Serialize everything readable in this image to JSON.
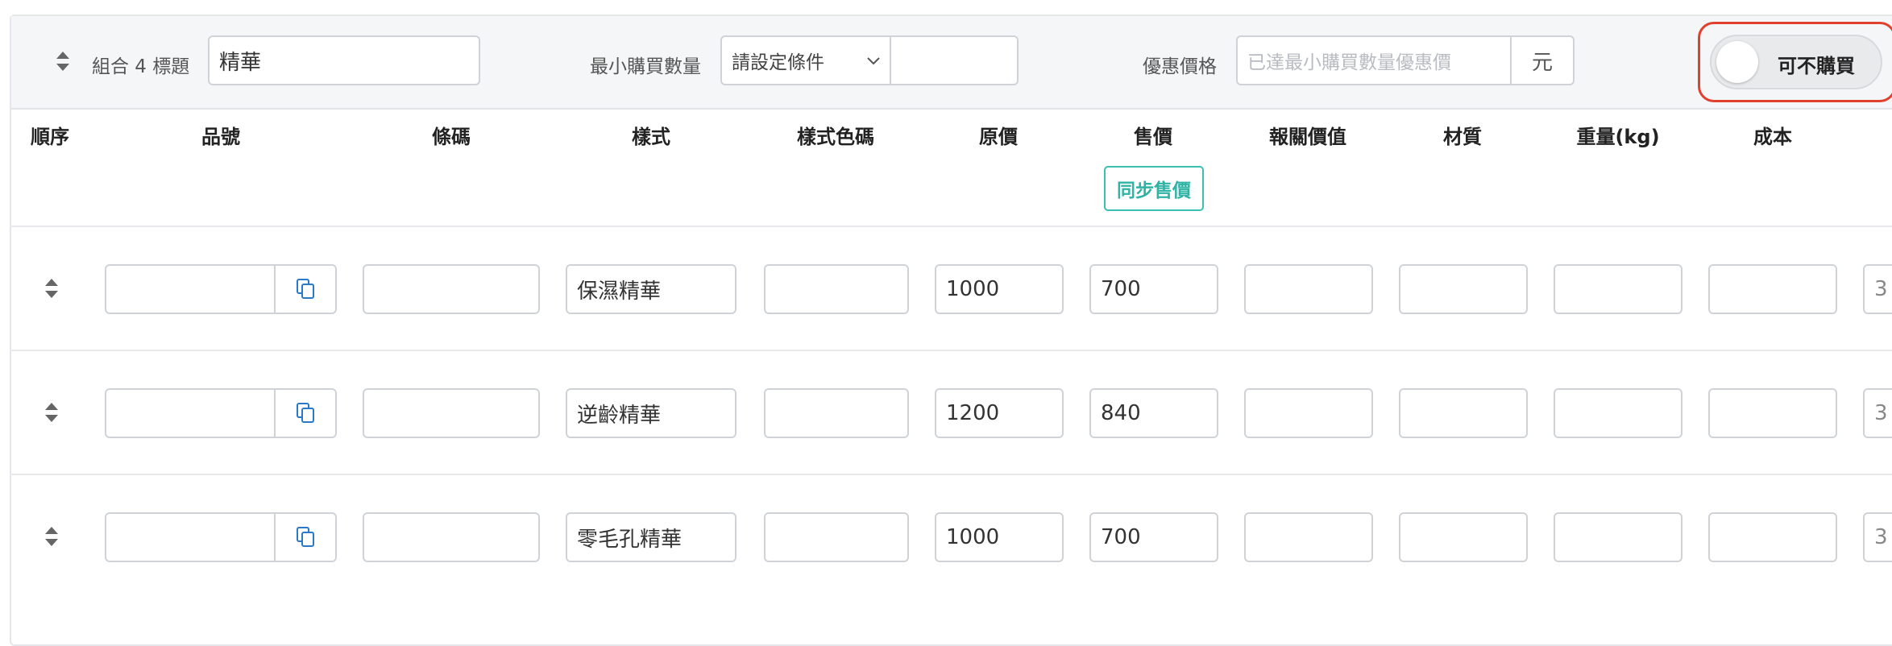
{
  "header": {
    "group_label": "組合 4 標題",
    "title_value": "精華",
    "min_qty_label": "最小購買數量",
    "min_qty_select": "請設定條件",
    "min_qty_value": "",
    "discount_label": "優惠價格",
    "discount_placeholder": "已達最小購買數量優惠價",
    "currency_unit": "元",
    "toggle_label": "可不購買"
  },
  "table": {
    "columns": [
      "順序",
      "品號",
      "條碼",
      "樣式",
      "樣式色碼",
      "原價",
      "售價",
      "報關價值",
      "材質",
      "重量(kg)",
      "成本"
    ],
    "sync_price_button": "同步售價",
    "rows": [
      {
        "sku": "",
        "barcode": "",
        "style": "保濕精華",
        "style_color": "",
        "original_price": "1000",
        "sale_price": "700",
        "customs_value": "",
        "material": "",
        "weight": "",
        "cost": "",
        "extra": "3"
      },
      {
        "sku": "",
        "barcode": "",
        "style": "逆齡精華",
        "style_color": "",
        "original_price": "1200",
        "sale_price": "840",
        "customs_value": "",
        "material": "",
        "weight": "",
        "cost": "",
        "extra": "3"
      },
      {
        "sku": "",
        "barcode": "",
        "style": "零毛孔精華",
        "style_color": "",
        "original_price": "1000",
        "sale_price": "700",
        "customs_value": "",
        "material": "",
        "weight": "",
        "cost": "",
        "extra": "3"
      }
    ]
  }
}
